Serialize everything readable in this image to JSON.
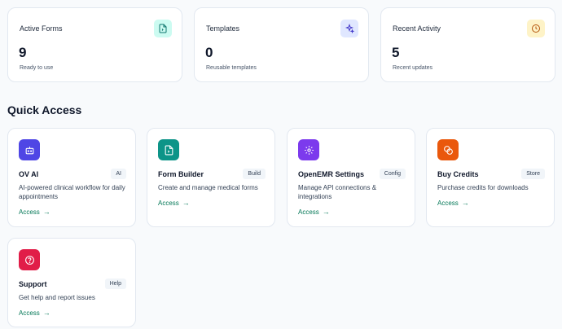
{
  "stats": [
    {
      "title": "Active Forms",
      "value": "9",
      "subtitle": "Ready to use",
      "icon": "file-icon",
      "icon_bg": "#ccfbf1",
      "icon_color": "#0f766e"
    },
    {
      "title": "Templates",
      "value": "0",
      "subtitle": "Reusable templates",
      "icon": "sparkle-icon",
      "icon_bg": "#e0e7ff",
      "icon_color": "#4338ca"
    },
    {
      "title": "Recent Activity",
      "value": "5",
      "subtitle": "Recent updates",
      "icon": "clock-icon",
      "icon_bg": "#fef3c7",
      "icon_color": "#b45309"
    }
  ],
  "quick_access": {
    "title": "Quick Access",
    "access_label": "Access",
    "cards": [
      {
        "title": "OV AI",
        "badge": "AI",
        "description": "AI-powered clinical workflow for daily appointments",
        "icon": "robot-icon",
        "icon_color": "#4f46e5"
      },
      {
        "title": "Form Builder",
        "badge": "Build",
        "description": "Create and manage medical forms",
        "icon": "file-icon",
        "icon_color": "#0d9488"
      },
      {
        "title": "OpenEMR Settings",
        "badge": "Config",
        "description": "Manage API connections & integrations",
        "icon": "gear-icon",
        "icon_color": "#7c3aed"
      },
      {
        "title": "Buy Credits",
        "badge": "Store",
        "description": "Purchase credits for downloads",
        "icon": "coins-icon",
        "icon_color": "#ea580c"
      },
      {
        "title": "Support",
        "badge": "Help",
        "description": "Get help and report issues",
        "icon": "help-icon",
        "icon_color": "#e11d48"
      }
    ]
  }
}
